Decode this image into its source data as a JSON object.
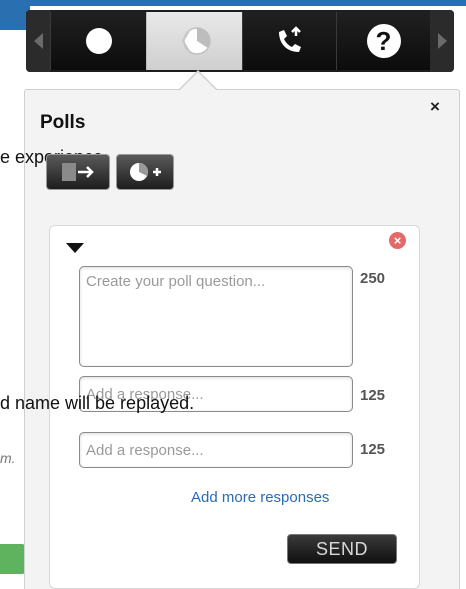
{
  "background": {
    "line1": "e experience.",
    "line2": "d name will be replayed.",
    "line3": "m."
  },
  "toolbar": {
    "items": [
      {
        "icon": "record-icon"
      },
      {
        "icon": "polls-icon",
        "active": true
      },
      {
        "icon": "phone-icon"
      },
      {
        "icon": "help-icon",
        "symbol": "?"
      }
    ]
  },
  "panel": {
    "title": "Polls",
    "close_symbol": "×"
  },
  "poll": {
    "question_placeholder": "Create your poll question...",
    "question_count": "250",
    "responses": [
      {
        "placeholder": "Add a response...",
        "count": "125"
      },
      {
        "placeholder": "Add a response...",
        "count": "125"
      }
    ],
    "add_more": "Add more responses",
    "send": "SEND"
  },
  "colors": {
    "accent_link": "#2b6ab5",
    "remove_red": "#e36a6a",
    "toolbar_bg": "#1e1e1e"
  }
}
